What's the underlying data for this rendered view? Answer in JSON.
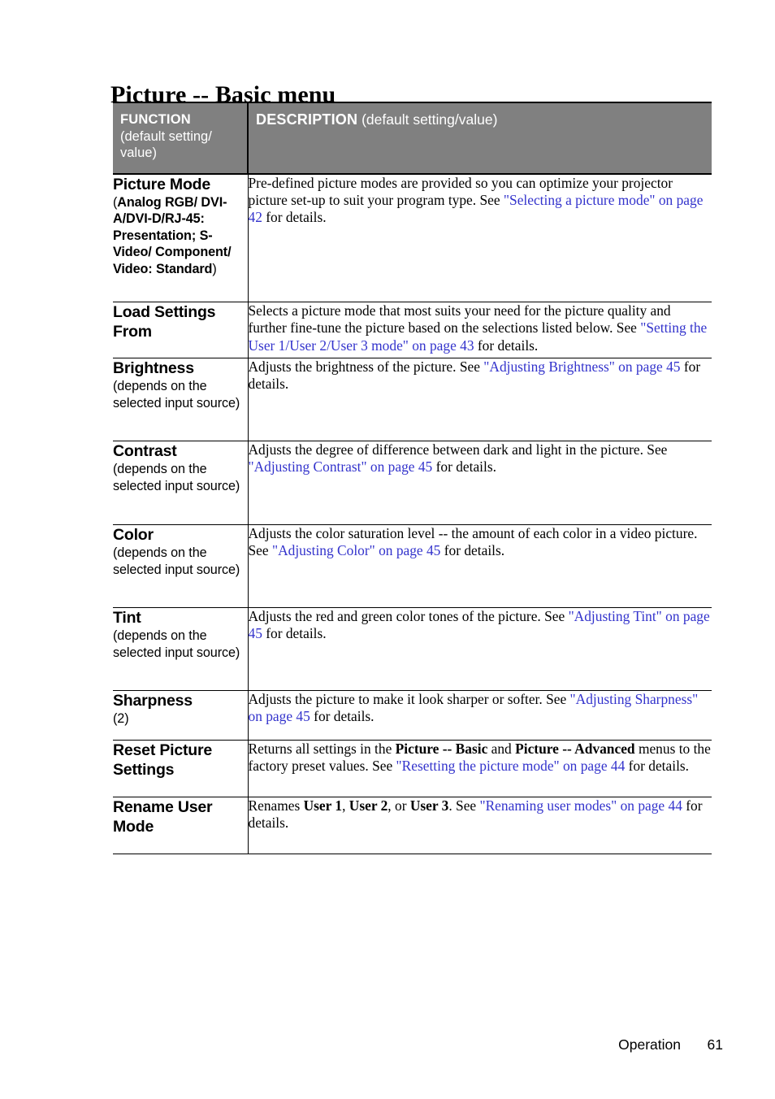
{
  "page": {
    "title": "Picture -- Basic menu",
    "footer_label": "Operation",
    "footer_page": "61"
  },
  "colors": {
    "header_bg": "#808080",
    "header_text": "#ffffff",
    "link": "#3333cc",
    "body_text": "#000000",
    "page_bg": "#ffffff"
  },
  "table": {
    "header": {
      "function_strong": "FUNCTION",
      "function_light": "(default setting/ value)",
      "description_strong": "DESCRIPTION",
      "description_light": "(default setting/value)"
    },
    "rows": [
      {
        "function": "Picture Mode",
        "function_sub": "(Analog RGB/ DVI-A/DVI-D/RJ-45: Presentation; S-Video/ Component/ Video: Standard)",
        "description": "Pre-defined picture modes are provided so you can optimize your projector picture set-up to suit your program type. See \"Selecting a picture mode\" on page 42 for details.",
        "description_link": "\"Selecting a picture mode\" on page 42"
      },
      {
        "function": "Load Settings From",
        "function_sub": "",
        "description": "Selects a picture mode that most suits your need for the picture quality and further fine-tune the picture based on the selections listed below. See \"Setting the User 1/User 2/User 3 mode\" on page 43 for details.",
        "description_link": "\"Setting the User 1/User 2/User 3 mode\" on page 43"
      },
      {
        "function": "Brightness",
        "function_sub": "(depends on the selected input source)",
        "description": "Adjusts the brightness of the picture. See \"Adjusting Brightness\" on page 45 for details.",
        "description_link": "\"Adjusting Brightness\" on page 45"
      },
      {
        "function": "Contrast",
        "function_sub": "(depends on the selected input source)",
        "description": "Adjusts the degree of difference between dark and light in the picture. See \"Adjusting Contrast\" on page 45 for details.",
        "description_link": "\"Adjusting Contrast\" on page 45"
      },
      {
        "function": "Color",
        "function_sub": "(depends on the selected input source)",
        "description": "Adjusts the color saturation level -- the amount of each color in a video picture. See \"Adjusting Color\" on page 45 for details.",
        "description_link": "\"Adjusting Color\" on page 45"
      },
      {
        "function": "Tint",
        "function_sub": "(depends on the selected input source)",
        "description": "Adjusts the red and green color tones of the picture. See \"Adjusting Tint\" on page 45 for details.",
        "description_link": "\"Adjusting Tint\" on page 45"
      },
      {
        "function": "Sharpness",
        "function_sub": "(2)",
        "description": "Adjusts the picture to make it look sharper or softer. See \"Adjusting Sharpness\" on page 45 for details.",
        "description_link": "\"Adjusting Sharpness\" on page 45"
      },
      {
        "function": "Reset Picture Settings",
        "function_sub": "",
        "description": "Returns all settings in the Picture -- Basic and  Picture -- Advanced menus to the factory preset values. See \"Resetting the picture mode\" on page 44 for details.",
        "description_link": "\"Resetting the picture mode\" on page 44"
      },
      {
        "function": "Rename User Mode",
        "function_sub": "",
        "description": "Renames User 1, User 2, or User 3. See \"Renaming user modes\" on page 44 for details.",
        "description_link": "\"Renaming user modes\" on page 44"
      }
    ],
    "row_fragments": {
      "picture_mode": {
        "plain1": "Pre-defined picture modes are provided so you can optimize your projector picture set-up to suit your program type. See ",
        "link": "\"Selecting a picture mode\" on page 42",
        "plain2": " for details."
      },
      "load_settings": {
        "plain1": "Selects a picture mode that most suits your need for the picture quality and further fine-tune the picture based on the selections listed below. See ",
        "link": "\"Setting the User 1/User 2/User 3 mode\" on page 43",
        "plain2": " for details."
      },
      "brightness": {
        "plain1": "Adjusts the brightness of the picture. See ",
        "link": "\"Adjusting Brightness\" on page 45",
        "plain2": " for details."
      },
      "contrast": {
        "plain1": "Adjusts the degree of difference between dark and light in the picture. See ",
        "link": "\"Adjusting Contrast\" on page 45",
        "plain2": " for details."
      },
      "color": {
        "plain1": "Adjusts the color saturation level -- the amount of each color in a video picture. See ",
        "link": "\"Adjusting Color\" on page 45",
        "plain2": " for details."
      },
      "tint": {
        "plain1": "Adjusts the red and green color tones of the picture. See ",
        "link": "\"Adjusting Tint\" on page 45",
        "plain2": " for details."
      },
      "sharpness": {
        "plain1": "Adjusts the picture to make it look sharper or softer. See ",
        "link": "\"Adjusting Sharpness\" on page 45",
        "plain2": " for details."
      },
      "reset": {
        "plain1": "Returns all settings in the ",
        "bold1": "Picture -- Basic",
        "plain2": " and  ",
        "bold2": "Picture -- Advanced",
        "plain3": " menus to the factory preset values. See ",
        "link": "\"Resetting the picture mode\" on page 44",
        "plain4": " for details."
      },
      "rename": {
        "plain1": "Renames ",
        "bold1": "User 1",
        "plain2": ", ",
        "bold2": "User 2",
        "plain3": ", or ",
        "bold3": "User 3",
        "plain4": ". See ",
        "link": "\"Renaming user modes\" on page 44",
        "plain5": " for details."
      }
    },
    "function_subs": {
      "picture_mode": {
        "open": "(",
        "bold": "Analog RGB/ DVI-A/DVI-D/RJ-45",
        "colon": ": ",
        "bold2": "Presentation",
        "semi": "; ",
        "bold3": "S-Video/ Component/ Video",
        "colon2": ": ",
        "bold4": "Standard",
        "close": ")"
      }
    }
  }
}
